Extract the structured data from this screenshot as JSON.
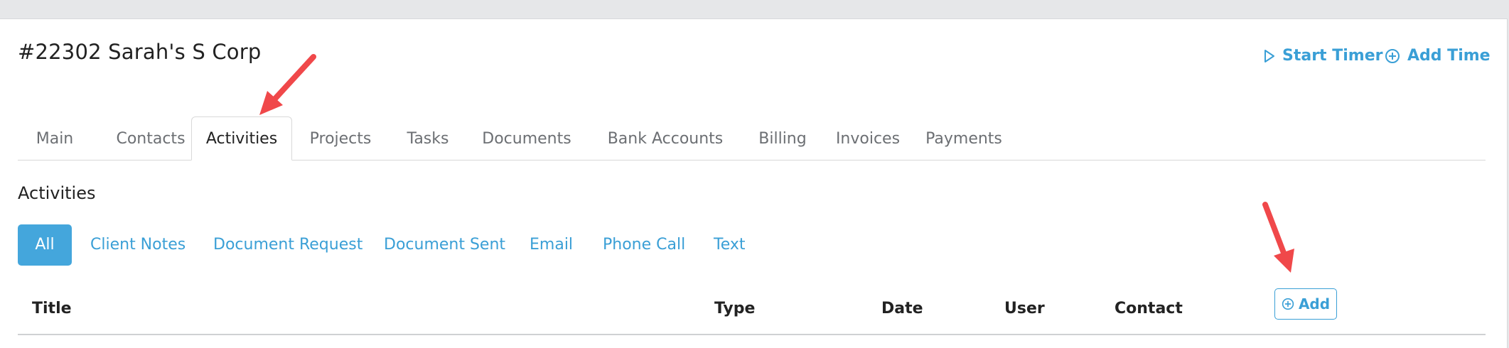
{
  "header": {
    "title": "#22302 Sarah's S Corp",
    "start_timer_label": "Start Timer",
    "add_time_label": "Add Time"
  },
  "tabs": [
    {
      "label": "Main"
    },
    {
      "label": "Contacts"
    },
    {
      "label": "Activities",
      "active": true
    },
    {
      "label": "Projects"
    },
    {
      "label": "Tasks"
    },
    {
      "label": "Documents"
    },
    {
      "label": "Bank Accounts"
    },
    {
      "label": "Billing"
    },
    {
      "label": "Invoices"
    },
    {
      "label": "Payments"
    }
  ],
  "section": {
    "title": "Activities",
    "filters": [
      {
        "label": "All",
        "active": true
      },
      {
        "label": "Client Notes"
      },
      {
        "label": "Document Request"
      },
      {
        "label": "Document Sent"
      },
      {
        "label": "Email"
      },
      {
        "label": "Phone Call"
      },
      {
        "label": "Text"
      }
    ]
  },
  "table": {
    "columns": [
      "Title",
      "Type",
      "Date",
      "User",
      "Contact"
    ],
    "add_label": "Add"
  },
  "colors": {
    "accent": "#3a9fd6",
    "active_filter_bg": "#44a6dc",
    "annotation_arrow": "#f0484a"
  },
  "icons": {
    "start_timer": "play-outline-icon",
    "add_time": "plus-circle-icon",
    "add": "plus-circle-icon",
    "annotation": "red-arrow"
  }
}
